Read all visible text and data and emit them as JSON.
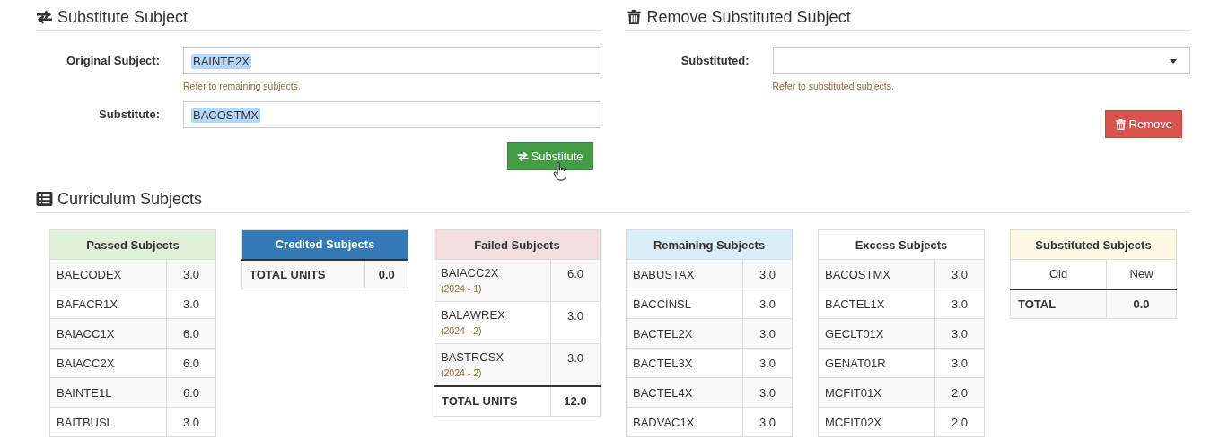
{
  "substitute": {
    "title": "Substitute Subject",
    "fields": [
      {
        "label": "Original Subject:",
        "value": "BAINTE2X",
        "help": "Refer to remaining subjects."
      },
      {
        "label": "Substitute:",
        "value": "BACOSTMX"
      }
    ],
    "button": "Substitute"
  },
  "remove": {
    "title": "Remove Substituted Subject",
    "fields": [
      {
        "label": "Substituted:",
        "help": "Refer to substituted subjects.",
        "kind": "select"
      }
    ],
    "button": "Remove"
  },
  "curriculum": {
    "title": "Curriculum Subjects",
    "tables": [
      {
        "title": "Passed Subjects",
        "color": "#dff0d8",
        "rows": [
          {
            "code": "BAECODEX",
            "units": "3.0"
          },
          {
            "code": "BAFACR1X",
            "units": "3.0"
          },
          {
            "code": "BAIACC1X",
            "units": "6.0"
          },
          {
            "code": "BAIACC2X",
            "units": "6.0"
          },
          {
            "code": "BAINTE1L",
            "units": "6.0"
          },
          {
            "code": "BAITBUSL",
            "units": "3.0"
          }
        ]
      },
      {
        "title": "Credited Subjects",
        "color": "#337ab7",
        "total": {
          "label": "TOTAL UNITS",
          "value": "0.0"
        }
      },
      {
        "title": "Failed Subjects",
        "color": "#f2dede",
        "rows": [
          {
            "code": "BAIACC2X",
            "units": "6.0",
            "term": "(2024 - 1)"
          },
          {
            "code": "BALAWREX",
            "units": "3.0",
            "term": "(2024 - 2)"
          },
          {
            "code": "BASTRCSX",
            "units": "3.0",
            "term": "(2024 - 2)"
          }
        ],
        "total": {
          "label": "TOTAL UNITS",
          "value": "12.0"
        }
      },
      {
        "title": "Remaining Subjects",
        "color": "#d9edf7",
        "rows": [
          {
            "code": "BABUSTAX",
            "units": "3.0"
          },
          {
            "code": "BACCINSL",
            "units": "3.0"
          },
          {
            "code": "BACTEL2X",
            "units": "3.0"
          },
          {
            "code": "BACTEL3X",
            "units": "3.0"
          },
          {
            "code": "BACTEL4X",
            "units": "3.0"
          },
          {
            "code": "BADVAC1X",
            "units": "3.0"
          }
        ]
      },
      {
        "title": "Excess Subjects",
        "color": "#ffffff",
        "rows": [
          {
            "code": "BACOSTMX",
            "units": "3.0"
          },
          {
            "code": "BACTEL1X",
            "units": "3.0"
          },
          {
            "code": "GECLT01X",
            "units": "3.0"
          },
          {
            "code": "GENAT01R",
            "units": "3.0"
          },
          {
            "code": "MCFIT01X",
            "units": "2.0"
          },
          {
            "code": "MCFIT02X",
            "units": "2.0"
          }
        ]
      },
      {
        "title": "Substituted Subjects",
        "color": "#fcf8e3",
        "columns": [
          "Old",
          "New"
        ],
        "total": {
          "label": "TOTAL",
          "value": "0.0"
        }
      }
    ]
  }
}
